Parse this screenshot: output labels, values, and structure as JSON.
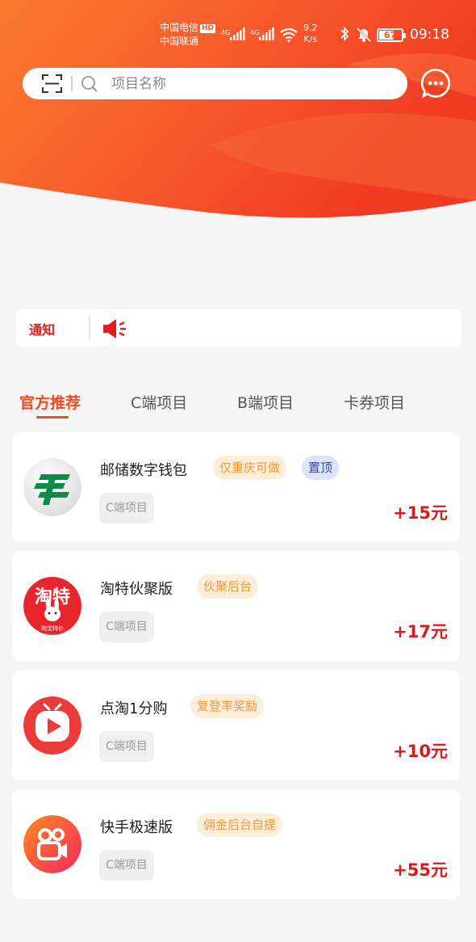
{
  "status_bar": {
    "carrier_1": "中国电信",
    "carrier_1_badge": "HD",
    "carrier_2": "中国联通",
    "net_type_1": "4G",
    "net_type_2": "4G",
    "net_speed_value": "9.2",
    "net_speed_unit": "K/s",
    "battery": "67",
    "time": "09:18",
    "icons": [
      "signal-icon",
      "wifi-icon",
      "bluetooth-icon",
      "mute-icon",
      "battery-icon"
    ]
  },
  "search": {
    "placeholder": "项目名称",
    "icons": [
      "scan-icon",
      "search-icon",
      "chat-icon"
    ]
  },
  "notice": {
    "label": "通知",
    "icon": "speaker-icon"
  },
  "tabs": [
    {
      "label": "官方推荐",
      "active": true
    },
    {
      "label": "C端项目",
      "active": false
    },
    {
      "label": "B端项目",
      "active": false
    },
    {
      "label": "卡券项目",
      "active": false
    }
  ],
  "projects": [
    {
      "name": "邮储数字钱包",
      "tags": [
        "仅重庆可做",
        "置顶"
      ],
      "type": "C端项目",
      "reward": "+15元",
      "logo": "postal-savings-logo"
    },
    {
      "name": "淘特伙聚版",
      "tags": [
        "伙聚后台"
      ],
      "type": "C端项目",
      "reward": "+17元",
      "logo": "taote-logo",
      "logo_text_1": "淘特",
      "logo_text_2": "淘宝特价"
    },
    {
      "name": "点淘1分购",
      "tags": [
        "复登率奖励"
      ],
      "type": "C端项目",
      "reward": "+10元",
      "logo": "diantao-logo"
    },
    {
      "name": "快手极速版",
      "tags": [
        "佣金后台自提"
      ],
      "type": "C端项目",
      "reward": "+55元",
      "logo": "kuaishou-logo"
    }
  ],
  "colors": {
    "accent": "#ee4a22",
    "reward": "#d61c1c",
    "tag_orange_bg": "#fdeed9",
    "tag_orange_text": "#ef9a3a",
    "tag_blue_bg": "#dde3f9",
    "tag_blue_text": "#3a4b93"
  }
}
